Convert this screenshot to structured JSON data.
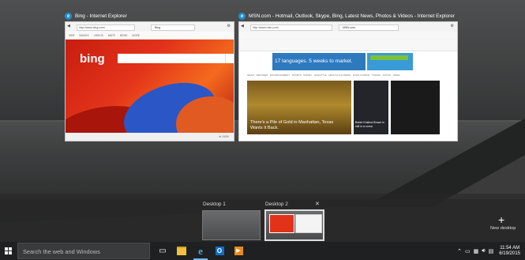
{
  "windows": [
    {
      "title": "Bing - Internet Explorer",
      "address": "http://www.bing.com/",
      "tab_label": "Bing",
      "nav": [
        "WEB",
        "IMAGES",
        "VIDEOS",
        "MAPS",
        "NEWS",
        "MORE"
      ],
      "logo": "bing"
    },
    {
      "title": "MSN.com - Hotmail, Outlook, Skype, Bing, Latest News, Photos & Videos - Internet Explorer",
      "address": "http://www.msn.com/",
      "tab_label": "MSN.com",
      "banner": "17 languages. 5 weeks to market.",
      "nav": [
        "NEWS",
        "WEATHER",
        "ENTERTAINMENT",
        "SPORTS",
        "MONEY",
        "LIFESTYLE",
        "HEALTH & FITNESS",
        "FOOD & DRINK",
        "TRAVEL",
        "AUTOS",
        "VIDEO"
      ],
      "hero_caption": "There's a Pile of Gold in Manhattan, Texas Wants It Back.",
      "side_caption": "Bobbi Kristina Brown is still in a coma"
    }
  ],
  "desktops": [
    {
      "label": "Desktop 1"
    },
    {
      "label": "Desktop 2"
    }
  ],
  "new_desktop": {
    "label": "New desktop",
    "plus": "+"
  },
  "close_glyph": "✕",
  "taskbar": {
    "search_placeholder": "Search the web and Windows",
    "time": "11:54 AM",
    "date": "6/19/2015"
  },
  "colors": {
    "accent": "#76b9ed",
    "taskbar": "#1f2021",
    "bing_red": "#e2321a",
    "msn_blue": "#2e7abf"
  }
}
